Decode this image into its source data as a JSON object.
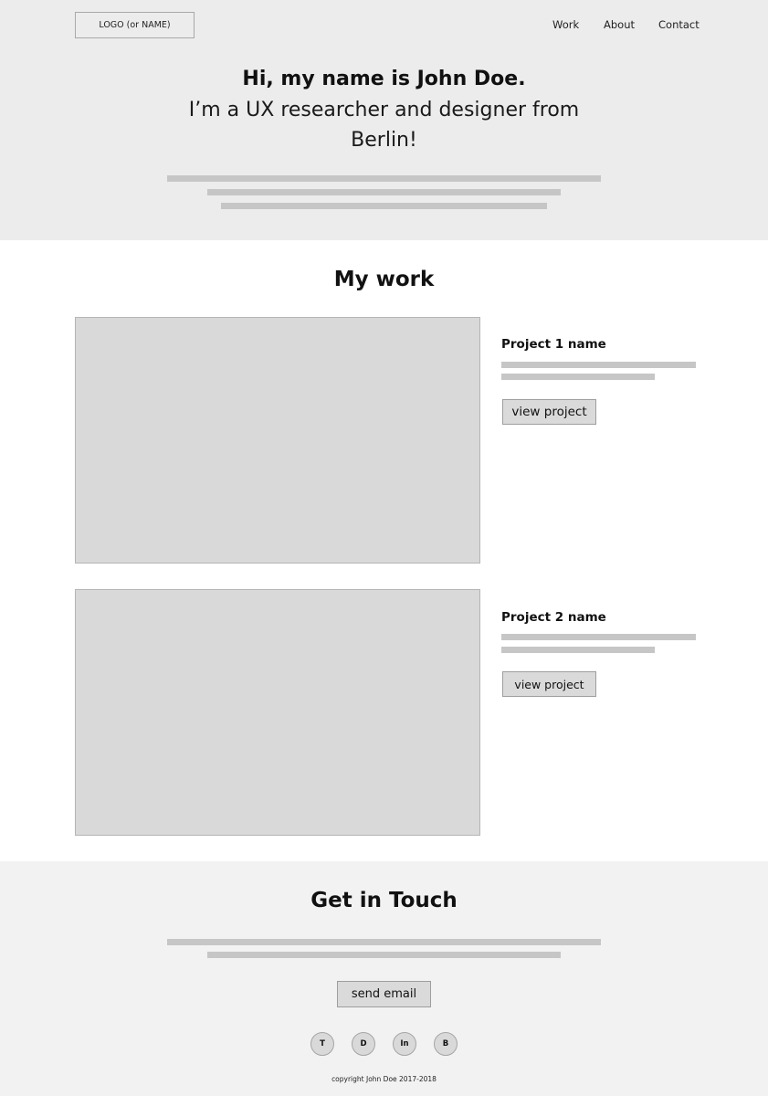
{
  "header": {
    "logo": "LOGO (or NAME)",
    "nav": [
      "Work",
      "About",
      "Contact"
    ]
  },
  "hero": {
    "title": "Hi, my name is John Doe.",
    "subtitle": "I’m a UX researcher and designer from Berlin!"
  },
  "work": {
    "title": "My work",
    "projects": [
      {
        "name": "Project 1 name",
        "button": "view project"
      },
      {
        "name": "Project 2 name",
        "button": "view project"
      }
    ]
  },
  "contact": {
    "title": "Get in Touch",
    "button": "send email",
    "social": [
      "T",
      "D",
      "In",
      "B"
    ],
    "copyright": "copyright John Doe 2017-2018"
  },
  "colors": {
    "hero_bg": "#ececec",
    "footer_bg": "#f2f2f2",
    "placeholder": "#d9d9d9",
    "text_line": "#c6c6c6"
  }
}
